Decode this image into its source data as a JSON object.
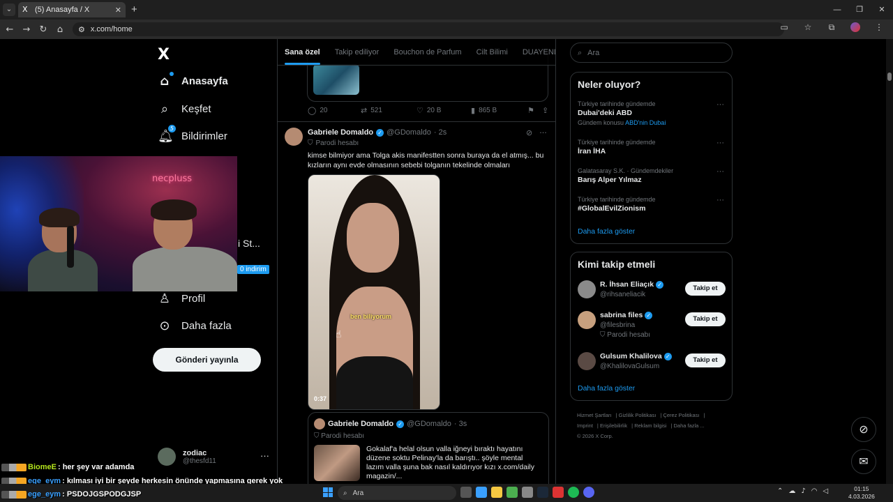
{
  "browser": {
    "tab_title": "(5) Anasayfa / X",
    "tab_favicon": "X",
    "url": "x.com/home"
  },
  "leftnav": {
    "logo": "X",
    "items": [
      {
        "label": "Anasayfa",
        "icon": "home-icon"
      },
      {
        "label": "Keşfet",
        "icon": "search-icon"
      },
      {
        "label": "Bildirimler",
        "icon": "bell-icon",
        "badge": "5"
      },
      {
        "label": "Profil",
        "icon": "person-icon"
      },
      {
        "label": "Daha fazla",
        "icon": "more-circle-icon"
      }
    ],
    "post_button": "Gönderi yayınla",
    "account": {
      "name": "zodiac",
      "handle": "@thesfd11"
    },
    "peek_text": "i St...",
    "peek_badge": "0 indirim"
  },
  "webcam": {
    "neon_sign": "necpluss"
  },
  "timeline": {
    "tabs": [
      "Sana özel",
      "Takip ediliyor",
      "Bouchon de Parfum",
      "Cilt Bilimi",
      "DUAYENLER"
    ],
    "prev_actions": {
      "replies": "20",
      "reposts": "521",
      "likes": "20 B",
      "views": "865 B"
    },
    "tweet": {
      "name": "Gabriele Domaldo",
      "handle": "@GDomaldo",
      "time": "· 2s",
      "parody": "Parodi hesabı",
      "text": "kimse bilmiyor ama Tolga akis manifestten sonra buraya da el atmış... bu kızların aynı evde olmasının sebebi tolganın tekelinde olmaları",
      "video_caption": "ben biliyorum",
      "video_time": "0:37"
    },
    "quote": {
      "name": "Gabriele Domaldo",
      "handle": "@GDomaldo",
      "time": "· 3s",
      "parody": "Parodi hesabı",
      "text": "Gokalaf'a helal olsun valla iğneyi bıraktı hayatını düzene soktu Pelinay'la da barıştı.. şöyle mental lazım valla şuna bak nasıl kaldırıyor kızı x.com/daily magazin/..."
    }
  },
  "right": {
    "search_placeholder": "Ara",
    "trends_title": "Neler oluyor?",
    "trends": [
      {
        "ctx": "Türkiye tarihinde gündemde",
        "title": "Dubai'deki ABD",
        "sub_prefix": "Gündem konusu",
        "sub_link": "ABD'nin Dubai"
      },
      {
        "ctx": "Türkiye tarihinde gündemde",
        "title": "İran İHA"
      },
      {
        "ctx": "Galatasaray S.K. · Gündemdekiler",
        "title": "Barış Alper Yılmaz"
      },
      {
        "ctx": "Türkiye tarihinde gündemde",
        "title": "#GlobalEvilZionism"
      }
    ],
    "show_more": "Daha fazla göster",
    "who_title": "Kimi takip etmeli",
    "who": [
      {
        "name": "R. İhsan Eliaçık",
        "handle": "@rihsaneliacik",
        "button": "Takip et"
      },
      {
        "name": "sabrina files",
        "handle": "@filesbrina",
        "parody": "Parodi hesabı",
        "button": "Takip et"
      },
      {
        "name": "Gulsum Khalilova",
        "handle": "@KhalilovaGulsum",
        "button": "Takip et"
      }
    ],
    "who_more": "Daha fazla göster",
    "footer": [
      "Hizmet Şartları",
      "Gizlilik Politikası",
      "Çerez Politikası",
      "Imprint",
      "Erişilebilirlik",
      "Reklam bilgisi",
      "Daha fazla ...",
      "© 2026 X Corp."
    ]
  },
  "chat": [
    {
      "user": "BiomeE",
      "msg": ": her şey var adamda"
    },
    {
      "user": "ege_eym",
      "msg": ": kılması iyi bir şeyde herkesin önünde yapmasına gerek yok"
    },
    {
      "user": "ege_eym",
      "msg": ": PSDOJGSPODGJSP"
    }
  ],
  "taskbar": {
    "search": "Ara",
    "time": "01:15",
    "date": "4.03.2026"
  },
  "colors": {
    "accent": "#1d9bf0",
    "background": "#000000",
    "border": "#2f3336",
    "muted": "#71767b"
  }
}
